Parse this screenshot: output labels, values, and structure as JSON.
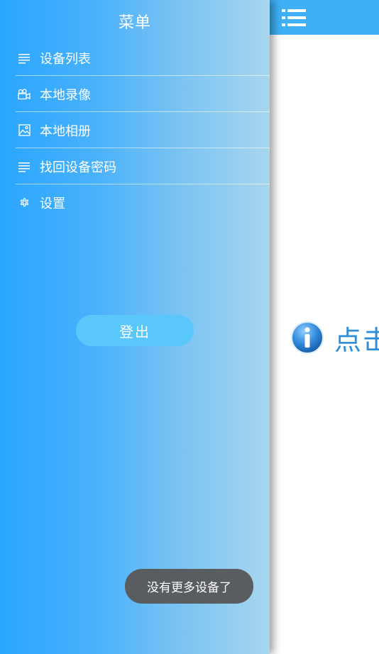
{
  "drawer": {
    "title": "菜单",
    "items": [
      {
        "label": "设备列表",
        "icon": "list-icon"
      },
      {
        "label": "本地录像",
        "icon": "video-camera-icon"
      },
      {
        "label": "本地相册",
        "icon": "image-icon"
      },
      {
        "label": "找回设备密码",
        "icon": "list-icon"
      },
      {
        "label": "设置",
        "icon": "gear-icon"
      }
    ],
    "logout_label": "登出"
  },
  "main": {
    "info_text": "点击",
    "info_icon": "info-icon",
    "menu_icon": "menu-list-icon"
  },
  "toast": {
    "text": "没有更多设备了"
  },
  "colors": {
    "topbar": "#3fb0f6",
    "drawer_start": "#2aa6ff",
    "drawer_end": "#a8d6ee",
    "logout_button": "#5ac7fb",
    "toast_bg": "#5a5d60",
    "info_text": "#2f8fd6"
  }
}
